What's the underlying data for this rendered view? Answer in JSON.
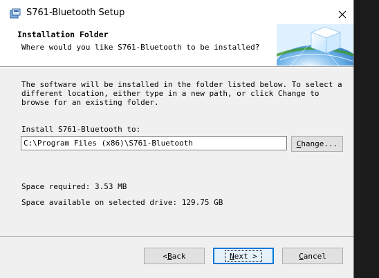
{
  "window": {
    "title": "S761-Bluetooth Setup"
  },
  "banner": {
    "title": "Installation Folder",
    "subtitle": "Where would you like S761-Bluetooth to be installed?"
  },
  "body": {
    "description": "The software will be installed in the folder listed below. To select a different location, either type in a new path, or click Change to browse for an existing folder.",
    "install_label": "Install S761-Bluetooth to:",
    "install_path": "C:\\Program Files (x86)\\S761-Bluetooth",
    "change_button": {
      "pre": "",
      "accel": "C",
      "post": "hange..."
    },
    "space_required": "Space required: 3.53 MB",
    "space_available": "Space available on selected drive: 129.75 GB"
  },
  "buttons": {
    "back": {
      "pre": "< ",
      "accel": "B",
      "post": "ack"
    },
    "next": {
      "pre": "",
      "accel": "N",
      "post": "ext >"
    },
    "cancel": {
      "pre": "",
      "accel": "C",
      "post": "ancel"
    }
  },
  "icons": {
    "app": "bluetooth-setup-icon",
    "close": "close-icon",
    "banner": "globe-cube-graphic"
  },
  "colors": {
    "window_bg": "#f0f0f0",
    "default_button_border": "#0078d7"
  }
}
